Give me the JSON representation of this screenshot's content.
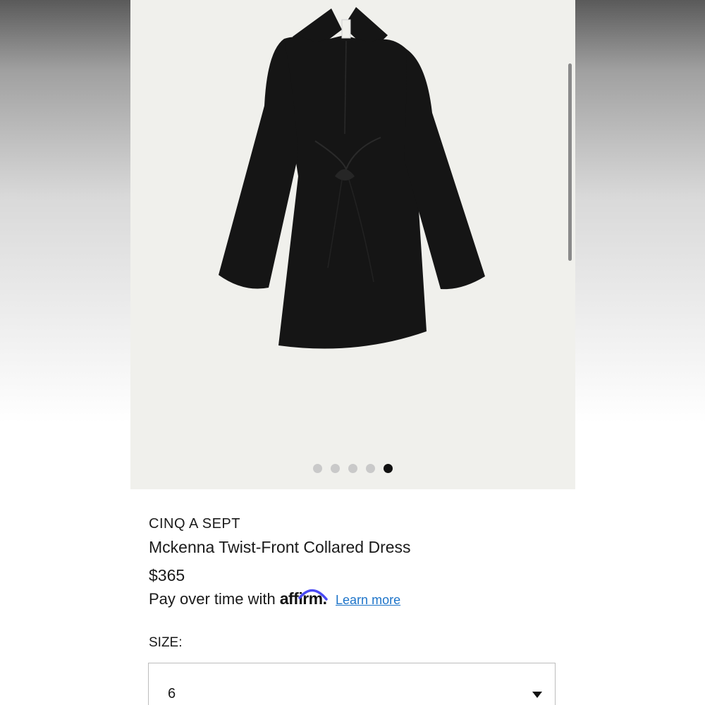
{
  "product": {
    "brand": "CINQ A SEPT",
    "name": "Mckenna Twist-Front Collared Dress",
    "price": "$365"
  },
  "gallery": {
    "image_count": 5,
    "active_index": 4,
    "dot_color_active": "#111111",
    "dot_color_inactive": "#c9c9c9"
  },
  "financing": {
    "text": "Pay over time with",
    "brand": "affirm",
    "brand_suffix": ".",
    "link": "Learn more"
  },
  "size": {
    "label": "SIZE:",
    "selected": "6"
  }
}
